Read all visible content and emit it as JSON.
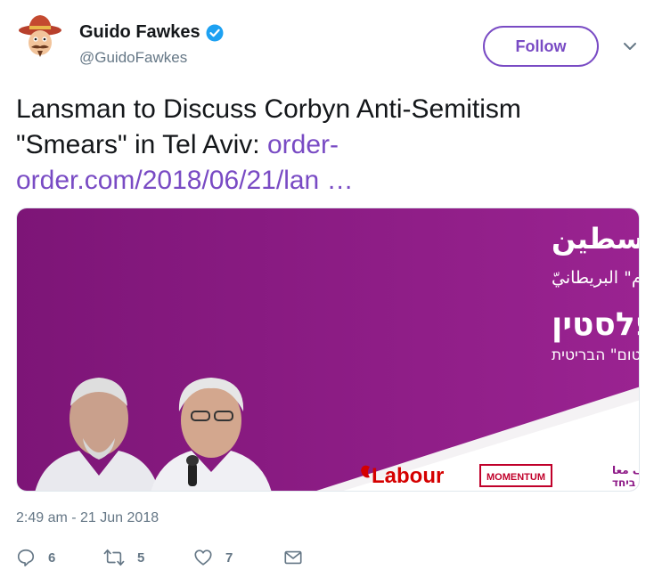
{
  "author": {
    "name": "Guido Fawkes",
    "handle": "@GuidoFawkes",
    "verified": true,
    "avatar_icon": "guy-fawkes-cartoon-avatar"
  },
  "follow_button": {
    "label": "Follow"
  },
  "tweet": {
    "text_line1": "Lansman to Discuss Corbyn Anti-Semitism",
    "text_line2_plain": "\"Smears\" in Tel Aviv: ",
    "link_part1": "order-",
    "link_part2": "order.com/2018/06/21/lan",
    "link_ellipsis": " …"
  },
  "media": {
    "arabic_title": "كوربين، ليبور، وإسرائيل-فلسطين",
    "arabic_subtitle": "محادثة مع جون لنسمان، رئيس حراك \"مومنتوم\" البريطانيّ",
    "hebrew_title": "קורבין, לייבור וישראל-פלסטין",
    "hebrew_subtitle": "שיחה עם ג'ון לנסמן, יושב-ראש תנועת \"מומנטום\" הבריטית",
    "logo_labour": "Labour",
    "logo_momentum": "MOMENTUM",
    "logo_standing_top": "نقف معا",
    "logo_standing_bottom": "עומדים ביחד",
    "colors": {
      "purple": "#8e1a87",
      "labour_red": "#d50000"
    }
  },
  "timestamp": "2:49 am - 21 Jun 2018",
  "actions": {
    "reply_count": "6",
    "retweet_count": "5",
    "like_count": "7"
  },
  "colors": {
    "accent": "#794bc4",
    "secondary_text": "#657786",
    "verified_blue": "#1da1f2"
  }
}
